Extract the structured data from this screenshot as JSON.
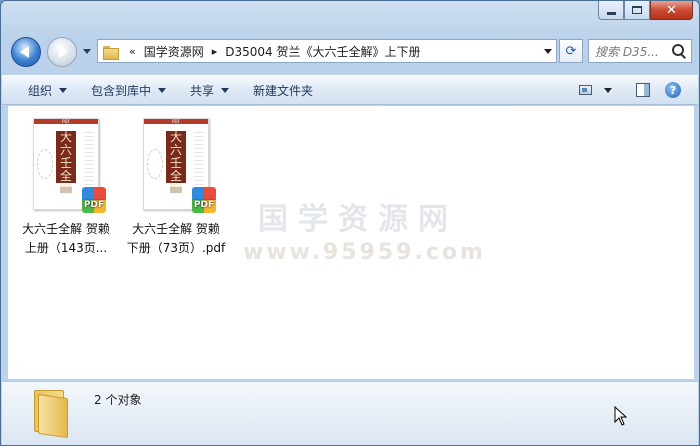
{
  "window": {
    "caption": {
      "close_glyph": "✕"
    }
  },
  "nav": {
    "breadcrumb_overflow": "«",
    "breadcrumb": [
      "国学资源网",
      "D35004 贺兰《大六壬全解》上下册"
    ],
    "search_placeholder": "搜索 D35...",
    "refresh_glyph": "⟳"
  },
  "toolbar": {
    "items": [
      {
        "label": "组织",
        "dropdown": true
      },
      {
        "label": "包含到库中",
        "dropdown": true
      },
      {
        "label": "共享",
        "dropdown": true
      },
      {
        "label": "新建文件夹",
        "dropdown": false
      }
    ],
    "help_glyph": "?"
  },
  "files": [
    {
      "name_line1": "大六壬全解 贺赖",
      "name_line2": "上册（143页...",
      "thumb_title": "大六壬全解",
      "thumb_top": "PDF",
      "badge": "PDF"
    },
    {
      "name_line1": "大六壬全解 贺赖",
      "name_line2": "下册（73页）.pdf",
      "thumb_title": "大六壬全解",
      "thumb_top": "PDF",
      "badge": "PDF"
    }
  ],
  "watermark": {
    "line1": "国学资源网",
    "line2": "www.95959.com"
  },
  "details": {
    "count_text": "2 个对象"
  },
  "colors": {
    "accent": "#3a7fd0",
    "close": "#cc4b33",
    "pdf_brown": "#7a2a1a"
  }
}
